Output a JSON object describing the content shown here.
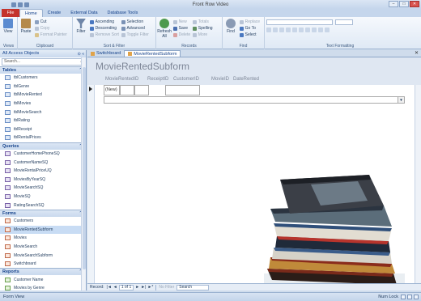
{
  "window": {
    "title": "Front Row Video"
  },
  "ribbon_tabs": [
    "Home",
    "Create",
    "External Data",
    "Database Tools"
  ],
  "file_tab": "File",
  "ribbon": {
    "views": {
      "view": "View",
      "label": "Views"
    },
    "clipboard": {
      "paste": "Paste",
      "cut": "Cut",
      "copy": "Copy",
      "format_painter": "Format Painter",
      "label": "Clipboard"
    },
    "sort_filter": {
      "filter": "Filter",
      "ascending": "Ascending",
      "descending": "Descending",
      "remove_sort": "Remove Sort",
      "selection": "Selection",
      "advanced": "Advanced",
      "toggle_filter": "Toggle Filter",
      "label": "Sort & Filter"
    },
    "records": {
      "refresh": "Refresh",
      "refresh_sub": "All",
      "new": "New",
      "save": "Save",
      "delete": "Delete",
      "totals": "Totals",
      "spelling": "Spelling",
      "more": "More",
      "label": "Records"
    },
    "find": {
      "find": "Find",
      "replace": "Replace",
      "goto": "Go To",
      "select": "Select",
      "label": "Find"
    },
    "text_formatting": {
      "label": "Text Formatting"
    }
  },
  "nav": {
    "header": "All Access Objects",
    "search_placeholder": "Search...",
    "groups": [
      {
        "name": "Tables",
        "type": "t",
        "items": [
          "tblCustomers",
          "tblGenre",
          "tblMovieRented",
          "tblMovies",
          "tblMovieSearch",
          "tblRating",
          "tblReceipt",
          "tblRentalPrices"
        ]
      },
      {
        "name": "Queries",
        "type": "q",
        "items": [
          "CustomerHomePhoneSQ",
          "CustomerNameSQ",
          "MovieRentalPriceUQ",
          "MoviesByYearSQ",
          "MovieSearchSQ",
          "MovieSQ",
          "RatingSearchSQ"
        ]
      },
      {
        "name": "Forms",
        "type": "f",
        "items": [
          "Customers",
          "MovieRentedSubform",
          "Movies",
          "MovieSearch",
          "MovieSearchSubform",
          "Switchboard"
        ]
      },
      {
        "name": "Reports",
        "type": "r",
        "items": [
          "Customer Name",
          "Movies by Genre"
        ]
      }
    ],
    "selected": "MovieRentedSubform"
  },
  "doc_tabs": [
    "Switchboard",
    "MovieRentedSubform"
  ],
  "active_doc_tab": "MovieRentedSubform",
  "form": {
    "title": "MovieRentedSubform",
    "columns": [
      "MovieRentedID",
      "ReceiptID",
      "CustomerID",
      "MovieID",
      "DateRented"
    ],
    "new_row_value": "(New)"
  },
  "record_nav": {
    "label": "Record:",
    "position": "1 of 1",
    "filter": "No Filter",
    "search": "Search"
  },
  "status": {
    "left": "Form View",
    "right": "Num Lock"
  }
}
